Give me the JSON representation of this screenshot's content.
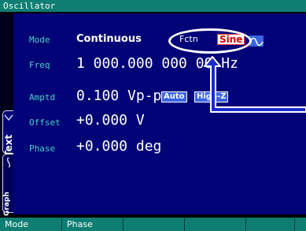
{
  "window": {
    "title": "Oscillator"
  },
  "params": {
    "mode": {
      "label": "Mode",
      "value": "Continuous"
    },
    "freq": {
      "label": "Freq",
      "value": "1 000.000 000 00 Hz"
    },
    "amptd": {
      "label": "Amptd",
      "value": "0.100 Vp-p"
    },
    "offset": {
      "label": "Offset",
      "value": "+0.000 V"
    },
    "phase": {
      "label": "Phase",
      "value": "+0.000 deg"
    }
  },
  "function": {
    "label": "Fctn",
    "selected": "Sine",
    "wave_icon": "sine-wave-icon"
  },
  "badges": {
    "auto": "Auto",
    "highz": "High-Z"
  },
  "side_tabs": {
    "text": "Text",
    "graph": "Graph"
  },
  "softkeys": [
    "Mode",
    "Phase",
    "",
    "",
    "",
    ""
  ],
  "colors": {
    "titlebar": "#0e7e73",
    "screen": "#020377",
    "param_label": "#44d4c4",
    "badge": "#3b63e6",
    "sine_text": "#e00000"
  }
}
